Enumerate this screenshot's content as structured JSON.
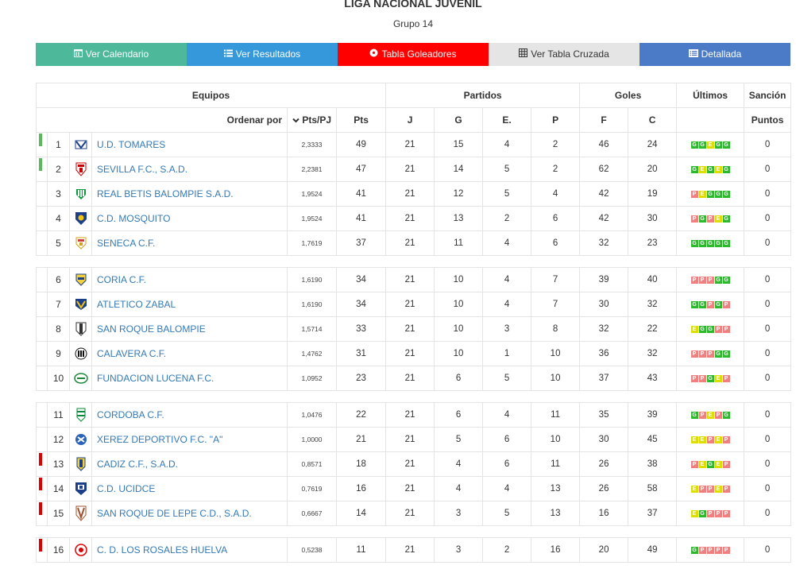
{
  "header": {
    "title": "LIGA NACIONAL JUVENIL",
    "subtitle": "Grupo 14"
  },
  "buttons": [
    {
      "label": "Ver Calendario",
      "icon": "calendar-icon",
      "color": "#4db89a"
    },
    {
      "label": "Ver Resultados",
      "icon": "list-icon",
      "color": "#3498db"
    },
    {
      "label": "Tabla Goleadores",
      "icon": "soccer-ball-icon",
      "color": "#ff0000"
    },
    {
      "label": "Ver Tabla Cruzada",
      "icon": "table-icon",
      "color": "#e5e5e5"
    },
    {
      "label": "Detallada",
      "icon": "list-alt-icon",
      "color": "#4b7bc7"
    }
  ],
  "table": {
    "group_headers": {
      "equipos": "Equipos",
      "partidos": "Partidos",
      "goles": "Goles",
      "ultimos": "Últimos",
      "sancion": "Sanción"
    },
    "sub_headers": {
      "ordenar": "Ordenar por",
      "ptspj": "Pts/PJ",
      "pts": "Pts",
      "j": "J",
      "g": "G",
      "e": "E.",
      "p": "P",
      "f": "F",
      "c": "C",
      "puntos": "Puntos"
    },
    "colors": {
      "promotion": "#5cb85c",
      "relegation": "#e00000",
      "win": "#2eb82e",
      "draw": "#dddd00",
      "loss": "#f08080"
    },
    "rows": [
      {
        "pos": "1",
        "team": "U.D. TOMARES",
        "ptspj": "2,3333",
        "pts": "49",
        "j": "21",
        "g": "15",
        "e": "4",
        "p": "2",
        "f": "46",
        "c": "24",
        "last": [
          "G",
          "G",
          "E",
          "G",
          "G"
        ],
        "sancion": "0",
        "mark": "promotion",
        "logo": "tomares"
      },
      {
        "pos": "2",
        "team": "SEVILLA F.C., S.A.D.",
        "ptspj": "2,2381",
        "pts": "47",
        "j": "21",
        "g": "14",
        "e": "5",
        "p": "2",
        "f": "62",
        "c": "20",
        "last": [
          "G",
          "E",
          "G",
          "E",
          "G"
        ],
        "sancion": "0",
        "mark": "promotion",
        "logo": "sevilla"
      },
      {
        "pos": "3",
        "team": "REAL BETIS BALOMPIE S.A.D.",
        "ptspj": "1,9524",
        "pts": "41",
        "j": "21",
        "g": "12",
        "e": "5",
        "p": "4",
        "f": "42",
        "c": "19",
        "last": [
          "P",
          "E",
          "G",
          "G",
          "G"
        ],
        "sancion": "0",
        "mark": "",
        "logo": "betis"
      },
      {
        "pos": "4",
        "team": "C.D. MOSQUITO",
        "ptspj": "1,9524",
        "pts": "41",
        "j": "21",
        "g": "13",
        "e": "2",
        "p": "6",
        "f": "42",
        "c": "30",
        "last": [
          "P",
          "G",
          "P",
          "E",
          "G"
        ],
        "sancion": "0",
        "mark": "",
        "logo": "mosquito"
      },
      {
        "pos": "5",
        "team": "SENECA C.F.",
        "ptspj": "1,7619",
        "pts": "37",
        "j": "21",
        "g": "11",
        "e": "4",
        "p": "6",
        "f": "32",
        "c": "23",
        "last": [
          "G",
          "G",
          "G",
          "G",
          "G"
        ],
        "sancion": "0",
        "mark": "",
        "logo": "seneca"
      },
      {
        "sep": true
      },
      {
        "pos": "6",
        "team": "CORIA C.F.",
        "ptspj": "1,6190",
        "pts": "34",
        "j": "21",
        "g": "10",
        "e": "4",
        "p": "7",
        "f": "39",
        "c": "40",
        "last": [
          "P",
          "P",
          "P",
          "G",
          "G"
        ],
        "sancion": "0",
        "mark": "",
        "logo": "coria"
      },
      {
        "pos": "7",
        "team": "ATLETICO ZABAL",
        "ptspj": "1,6190",
        "pts": "34",
        "j": "21",
        "g": "10",
        "e": "4",
        "p": "7",
        "f": "30",
        "c": "32",
        "last": [
          "G",
          "G",
          "P",
          "G",
          "P"
        ],
        "sancion": "0",
        "mark": "",
        "logo": "zabal"
      },
      {
        "pos": "8",
        "team": "SAN ROQUE BALOMPIE",
        "ptspj": "1,5714",
        "pts": "33",
        "j": "21",
        "g": "10",
        "e": "3",
        "p": "8",
        "f": "32",
        "c": "22",
        "last": [
          "E",
          "G",
          "G",
          "P",
          "P"
        ],
        "sancion": "0",
        "mark": "",
        "logo": "sanroque"
      },
      {
        "pos": "9",
        "team": "CALAVERA C.F.",
        "ptspj": "1,4762",
        "pts": "31",
        "j": "21",
        "g": "10",
        "e": "1",
        "p": "10",
        "f": "36",
        "c": "32",
        "last": [
          "P",
          "P",
          "P",
          "G",
          "G"
        ],
        "sancion": "0",
        "mark": "",
        "logo": "calavera"
      },
      {
        "pos": "10",
        "team": "FUNDACION LUCENA F.C.",
        "ptspj": "1,0952",
        "pts": "23",
        "j": "21",
        "g": "6",
        "e": "5",
        "p": "10",
        "f": "37",
        "c": "43",
        "last": [
          "P",
          "P",
          "G",
          "E",
          "P"
        ],
        "sancion": "0",
        "mark": "",
        "logo": "lucena"
      },
      {
        "sep": true
      },
      {
        "pos": "11",
        "team": "CORDOBA C.F.",
        "ptspj": "1,0476",
        "pts": "22",
        "j": "21",
        "g": "6",
        "e": "4",
        "p": "11",
        "f": "35",
        "c": "39",
        "last": [
          "G",
          "P",
          "E",
          "P",
          "G"
        ],
        "sancion": "0",
        "mark": "",
        "logo": "cordoba"
      },
      {
        "pos": "12",
        "team": "XEREZ DEPORTIVO F.C. \"A\"",
        "ptspj": "1,0000",
        "pts": "21",
        "j": "21",
        "g": "5",
        "e": "6",
        "p": "10",
        "f": "30",
        "c": "45",
        "last": [
          "E",
          "E",
          "P",
          "E",
          "P"
        ],
        "sancion": "0",
        "mark": "",
        "logo": "xerez"
      },
      {
        "pos": "13",
        "team": "CADIZ C.F., S.A.D.",
        "ptspj": "0,8571",
        "pts": "18",
        "j": "21",
        "g": "4",
        "e": "6",
        "p": "11",
        "f": "26",
        "c": "38",
        "last": [
          "P",
          "E",
          "G",
          "E",
          "P"
        ],
        "sancion": "0",
        "mark": "relegation",
        "logo": "cadiz"
      },
      {
        "pos": "14",
        "team": "C.D. UCIDCE",
        "ptspj": "0,7619",
        "pts": "16",
        "j": "21",
        "g": "4",
        "e": "4",
        "p": "13",
        "f": "26",
        "c": "58",
        "last": [
          "E",
          "P",
          "P",
          "E",
          "P"
        ],
        "sancion": "0",
        "mark": "relegation",
        "logo": "ucidce"
      },
      {
        "pos": "15",
        "team": "SAN ROQUE DE LEPE C.D., S.A.D.",
        "ptspj": "0,6667",
        "pts": "14",
        "j": "21",
        "g": "3",
        "e": "5",
        "p": "13",
        "f": "16",
        "c": "37",
        "last": [
          "E",
          "G",
          "P",
          "P",
          "P"
        ],
        "sancion": "0",
        "mark": "relegation",
        "logo": "lepe"
      },
      {
        "sep": true
      },
      {
        "pos": "16",
        "team": "C. D. LOS ROSALES HUELVA",
        "ptspj": "0,5238",
        "pts": "11",
        "j": "21",
        "g": "3",
        "e": "2",
        "p": "16",
        "f": "20",
        "c": "49",
        "last": [
          "G",
          "P",
          "P",
          "P",
          "P"
        ],
        "sancion": "0",
        "mark": "relegation",
        "logo": "rosales"
      }
    ]
  }
}
